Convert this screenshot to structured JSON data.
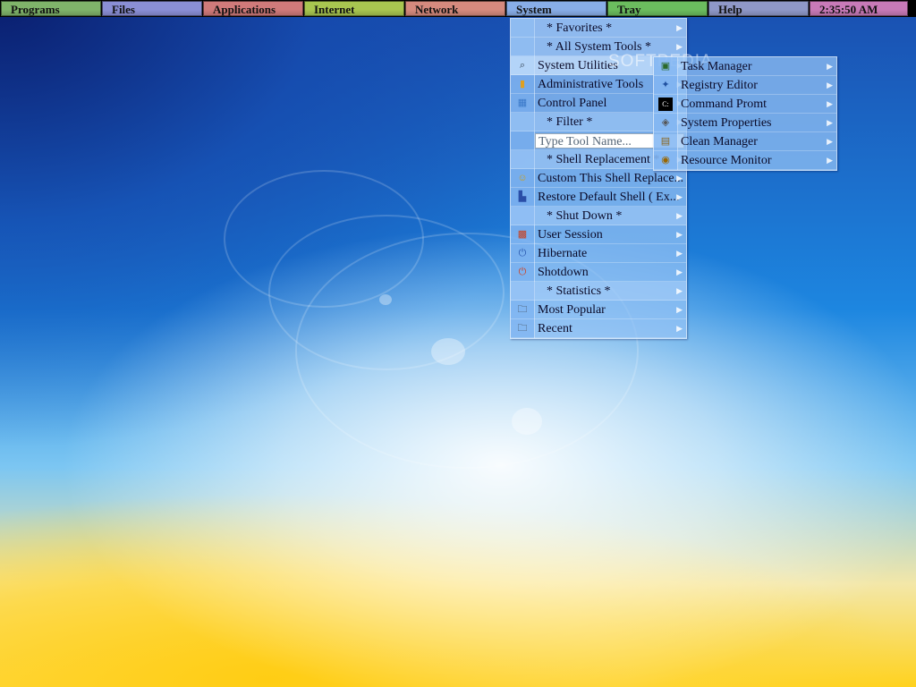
{
  "taskbar": {
    "buttons": [
      {
        "label": "Programs",
        "color": "#7fb46a"
      },
      {
        "label": "Files",
        "color": "#8a8fd6"
      },
      {
        "label": "Applications",
        "color": "#d07a7a"
      },
      {
        "label": "Internet",
        "color": "#a8c650"
      },
      {
        "label": "Network",
        "color": "#d58a7e"
      },
      {
        "label": "System",
        "color": "#88aee8"
      },
      {
        "label": "Tray",
        "color": "#6bbd5e"
      },
      {
        "label": "Help",
        "color": "#8f98c8"
      }
    ],
    "clock": {
      "label": "2:35:50 AM",
      "color": "#c87ab8"
    }
  },
  "system_menu": {
    "items": [
      {
        "label": "* Favorites *",
        "kind": "head",
        "icon": ""
      },
      {
        "label": "* All System Tools *",
        "kind": "head",
        "icon": ""
      },
      {
        "label": "System Utilities",
        "kind": "item",
        "icon": "magnifier-icon",
        "highlight": true
      },
      {
        "label": "Administrative Tools",
        "kind": "item",
        "icon": "folder-tools-icon"
      },
      {
        "label": "Control Panel",
        "kind": "item",
        "icon": "control-panel-icon"
      },
      {
        "label": "* Filter *",
        "kind": "head",
        "icon": ""
      },
      {
        "label": "Type Tool Name...",
        "kind": "search",
        "icon": ""
      },
      {
        "label": "* Shell Replacement *",
        "kind": "head",
        "icon": ""
      },
      {
        "label": "Custom This Shell Replace...",
        "kind": "item",
        "icon": "custom-shell-icon"
      },
      {
        "label": "Restore Default Shell ( Ex...",
        "kind": "item",
        "icon": "restore-shell-icon"
      },
      {
        "label": "* Shut Down *",
        "kind": "head",
        "icon": ""
      },
      {
        "label": "User Session",
        "kind": "item",
        "icon": "user-session-icon"
      },
      {
        "label": "Hibernate",
        "kind": "item",
        "icon": "hibernate-icon"
      },
      {
        "label": "Shotdown",
        "kind": "item",
        "icon": "shutdown-icon"
      },
      {
        "label": "* Statistics *",
        "kind": "head",
        "icon": ""
      },
      {
        "label": "Most Popular",
        "kind": "item",
        "icon": "folder-icon"
      },
      {
        "label": "Recent",
        "kind": "item",
        "icon": "folder-icon"
      }
    ]
  },
  "submenu": {
    "items": [
      {
        "label": "Task Manager",
        "icon": "task-manager-icon"
      },
      {
        "label": "Registry Editor",
        "icon": "registry-editor-icon"
      },
      {
        "label": "Command Promt",
        "icon": "command-prompt-icon"
      },
      {
        "label": "System Properties",
        "icon": "system-properties-icon"
      },
      {
        "label": "Clean Manager",
        "icon": "clean-manager-icon"
      },
      {
        "label": "Resource Monitor",
        "icon": "resource-monitor-icon"
      }
    ]
  },
  "watermark": "SOFTPEDIA"
}
